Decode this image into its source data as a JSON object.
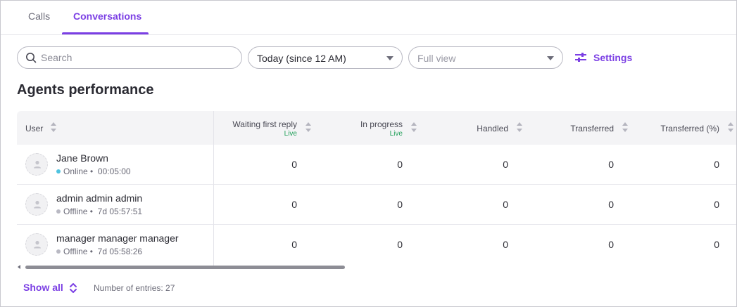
{
  "tabs": [
    {
      "label": "Calls",
      "active": false
    },
    {
      "label": "Conversations",
      "active": true
    }
  ],
  "filters": {
    "search_placeholder": "Search",
    "period": "Today (since 12 AM)",
    "view_placeholder": "Full view",
    "settings_label": "Settings"
  },
  "heading": "Agents performance",
  "table": {
    "columns": [
      {
        "label": "User",
        "live": ""
      },
      {
        "label": "Waiting first reply",
        "live": "Live"
      },
      {
        "label": "In progress",
        "live": "Live"
      },
      {
        "label": "Handled",
        "live": ""
      },
      {
        "label": "Transferred",
        "live": ""
      },
      {
        "label": "Transferred (%)",
        "live": ""
      }
    ],
    "rows": [
      {
        "name": "Jane Brown",
        "status": "Online",
        "status_color": "#4fc3e0",
        "time": "00:05:00",
        "values": [
          "0",
          "0",
          "0",
          "0",
          "0"
        ]
      },
      {
        "name": "admin admin admin",
        "status": "Offline",
        "status_color": "#b9b9c3",
        "time": "7d 05:57:51",
        "values": [
          "0",
          "0",
          "0",
          "0",
          "0"
        ]
      },
      {
        "name": "manager manager manager",
        "status": "Offline",
        "status_color": "#b9b9c3",
        "time": "7d 05:58:26",
        "values": [
          "0",
          "0",
          "0",
          "0",
          "0"
        ]
      }
    ]
  },
  "footer": {
    "show_all": "Show all",
    "entries_label": "Number of entries: 27"
  },
  "colors": {
    "accent": "#7b3fe4",
    "live": "#22a05a"
  },
  "icons": [
    "search-icon",
    "chevron-down-icon",
    "settings-sliders-icon",
    "sort-icon",
    "user-avatar-icon",
    "expand-icon"
  ]
}
